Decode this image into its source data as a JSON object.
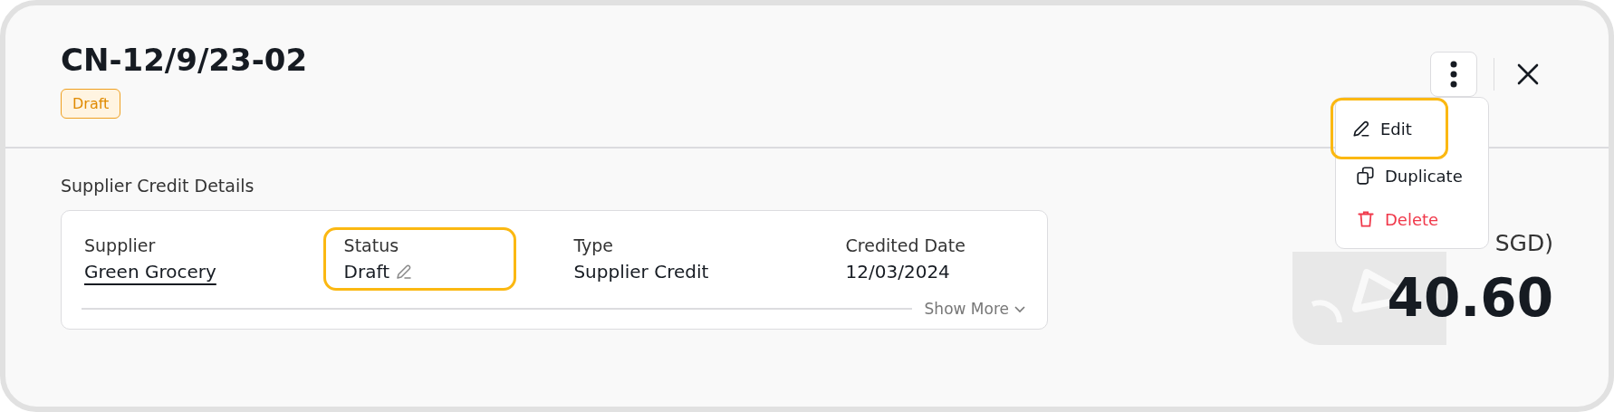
{
  "header": {
    "title": "CN-12/9/23-02",
    "badge": "Draft"
  },
  "section": {
    "title": "Supplier Credit Details",
    "fields": [
      {
        "label": "Supplier",
        "value": "Green Grocery",
        "kind": "link",
        "highlighted": false
      },
      {
        "label": "Status",
        "value": "Draft",
        "kind": "editable",
        "highlighted": true
      },
      {
        "label": "Type",
        "value": "Supplier Credit",
        "kind": "text",
        "highlighted": false
      },
      {
        "label": "Credited Date",
        "value": "12/03/2024",
        "kind": "text",
        "highlighted": false
      }
    ],
    "show_more": "Show More"
  },
  "amount": {
    "label": "SGD)",
    "value": "40.60"
  },
  "menu": {
    "items": [
      {
        "label": "Edit",
        "kind": "edit",
        "highlighted": true
      },
      {
        "label": "Duplicate",
        "kind": "duplicate",
        "highlighted": false
      },
      {
        "label": "Delete",
        "kind": "delete",
        "highlighted": false
      }
    ]
  }
}
